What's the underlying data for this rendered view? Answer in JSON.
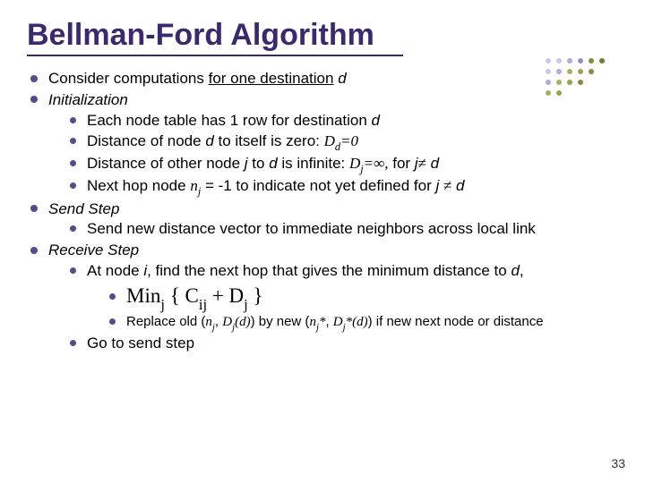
{
  "title": "Bellman-Ford Algorithm",
  "page_number": "33",
  "bullets": {
    "consider_pre": "Consider computations ",
    "consider_udl": "for one destination",
    "consider_post": " d",
    "init": "Initialization",
    "init_row": "Each node table has 1 row for destination ",
    "init_row_d": "d",
    "init_zero_a": "Distance of node ",
    "init_zero_b": "d",
    "init_zero_c": " to itself is zero:  ",
    "init_zero_expr": "D",
    "init_zero_sub": "d",
    "init_zero_eq": "=0",
    "init_inf_a": "Distance of other node ",
    "init_inf_b": "j",
    "init_inf_c": " to ",
    "init_inf_d": "d",
    "init_inf_e": " is infinite:  ",
    "init_inf_expr": "D",
    "init_inf_sub": "j",
    "init_inf_eq": "=∞,",
    "init_inf_for": " for ",
    "init_inf_j": "j",
    "init_inf_ne": "≠",
    "init_inf_dd": " d",
    "init_next_a": "Next hop node ",
    "init_next_n": "n",
    "init_next_sub": "j",
    "init_next_b": " = -1 to indicate not yet defined for ",
    "init_next_j": "j ",
    "init_next_ne": "≠",
    "init_next_d": " d",
    "send": "Send Step",
    "send_sub": "Send new distance vector to immediate neighbors across local link",
    "recv": "Receive Step",
    "recv_at_a": "At node ",
    "recv_at_i": "i",
    "recv_at_b": ", find the next hop that gives the minimum distance to ",
    "recv_at_d": "d",
    "recv_at_c": ",",
    "min_expr": "Min",
    "min_sub": "j",
    "min_body1": " { C",
    "min_body1_sub": "ij",
    "min_plus": " + D",
    "min_body2_sub": "j",
    "min_close": " }",
    "replace_a": "Replace old (",
    "replace_n": "n",
    "replace_nsub": "j",
    "replace_b": ", ",
    "replace_D": "D",
    "replace_Dsub": "j",
    "replace_d": "(d)",
    "replace_c": ") by new (",
    "replace_n2": "n",
    "replace_n2sub": "j",
    "replace_star": "*",
    "replace_e": ", ",
    "replace_D2": "D",
    "replace_D2sub": "j",
    "replace_star2": "*",
    "replace_d2": "(d)",
    "replace_f": ") if new next node or distance",
    "goto": "Go to send step"
  }
}
